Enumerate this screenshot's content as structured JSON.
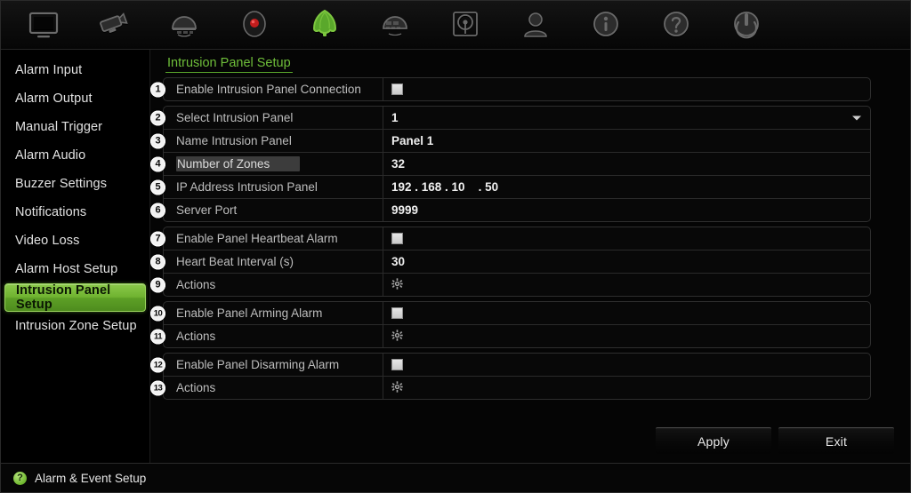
{
  "toolbar": {
    "items": [
      {
        "icon": "display-monitor-icon",
        "name": "display-settings"
      },
      {
        "icon": "camera-icon",
        "name": "camera-settings"
      },
      {
        "icon": "record-schedule-icon",
        "name": "recording-settings"
      },
      {
        "icon": "record-dot-icon",
        "name": "manual-record"
      },
      {
        "icon": "alarm-bell-icon",
        "name": "alarm-event-setup",
        "active": true
      },
      {
        "icon": "network-icon",
        "name": "network-settings"
      },
      {
        "icon": "hard-drive-icon",
        "name": "storage-settings"
      },
      {
        "icon": "user-icon",
        "name": "user-management"
      },
      {
        "icon": "info-icon",
        "name": "system-information"
      },
      {
        "icon": "help-icon",
        "name": "help"
      },
      {
        "icon": "power-icon",
        "name": "shutdown"
      }
    ]
  },
  "sidebar": {
    "items": [
      {
        "label": "Alarm Input",
        "active": false
      },
      {
        "label": "Alarm Output",
        "active": false
      },
      {
        "label": "Manual Trigger",
        "active": false
      },
      {
        "label": "Alarm Audio",
        "active": false
      },
      {
        "label": "Buzzer Settings",
        "active": false
      },
      {
        "label": "Notifications",
        "active": false
      },
      {
        "label": "Video Loss",
        "active": false
      },
      {
        "label": "Alarm Host Setup",
        "active": false
      },
      {
        "label": "Intrusion Panel Setup",
        "active": true
      },
      {
        "label": "Intrusion Zone Setup",
        "active": false
      }
    ]
  },
  "tab": {
    "title": "Intrusion Panel Setup"
  },
  "form": {
    "groups": [
      {
        "rows": [
          {
            "num": "1",
            "label": "Enable Intrusion Panel Connection",
            "type": "checkbox",
            "value": "",
            "checked": false,
            "highlight": false
          }
        ]
      },
      {
        "rows": [
          {
            "num": "2",
            "label": "Select Intrusion Panel",
            "type": "select",
            "value": "1",
            "highlight": false
          },
          {
            "num": "3",
            "label": "Name Intrusion Panel",
            "type": "text",
            "value": "Panel 1",
            "highlight": false
          },
          {
            "num": "4",
            "label": "Number of Zones",
            "type": "text",
            "value": "32",
            "highlight": true
          },
          {
            "num": "5",
            "label": "IP Address Intrusion Panel",
            "type": "text",
            "value": "192 . 168 . 10    . 50",
            "highlight": false
          },
          {
            "num": "6",
            "label": "Server Port",
            "type": "text",
            "value": "9999",
            "highlight": false
          }
        ]
      },
      {
        "rows": [
          {
            "num": "7",
            "label": "Enable Panel Heartbeat Alarm",
            "type": "checkbox",
            "value": "",
            "checked": false,
            "highlight": false
          },
          {
            "num": "8",
            "label": "Heart Beat Interval (s)",
            "type": "text",
            "value": "30",
            "highlight": false
          },
          {
            "num": "9",
            "label": "Actions",
            "type": "gear",
            "value": "",
            "highlight": false
          }
        ]
      },
      {
        "rows": [
          {
            "num": "10",
            "label": "Enable Panel Arming Alarm",
            "type": "checkbox",
            "value": "",
            "checked": false,
            "highlight": false
          },
          {
            "num": "11",
            "label": "Actions",
            "type": "gear",
            "value": "",
            "highlight": false
          }
        ]
      },
      {
        "rows": [
          {
            "num": "12",
            "label": "Enable Panel Disarming Alarm",
            "type": "checkbox",
            "value": "",
            "checked": false,
            "highlight": false
          },
          {
            "num": "13",
            "label": "Actions",
            "type": "gear",
            "value": "",
            "highlight": false
          }
        ]
      }
    ]
  },
  "buttons": {
    "apply": "Apply",
    "exit": "Exit"
  },
  "statusbar": {
    "icon": "help-circle-icon",
    "icon_glyph": "?",
    "text": "Alarm & Event Setup"
  },
  "colors": {
    "accent_green": "#6fbf3a",
    "active_item_green": "#6fb330",
    "background": "#050505",
    "row_border": "#2a2a2a",
    "label_text": "#bdbdbd",
    "value_text": "#f0f0f0"
  }
}
